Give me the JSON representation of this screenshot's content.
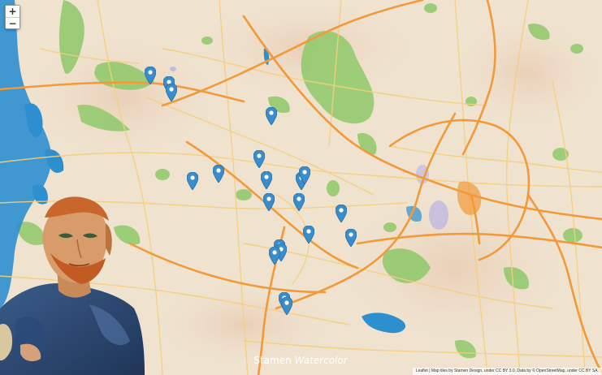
{
  "map": {
    "zoom_in_label": "+",
    "zoom_out_label": "−",
    "marker_icon": "map-pin-icon",
    "marker_color": "#3a8dcb",
    "marker_count": 23
  },
  "caption": {
    "part1": "Stamen ",
    "part2": "Watercolor"
  },
  "attribution": "Leaflet | Map tiles by Stamen Design, under CC BY 3.0. Data by © OpenStreetMap, under CC BY SA.",
  "colors": {
    "land": "#efe3d0",
    "water": "#2e8fcf",
    "parks": "#8fc96a",
    "major_roads": "#f29a3a",
    "minor_roads": "#f6cf7a"
  }
}
